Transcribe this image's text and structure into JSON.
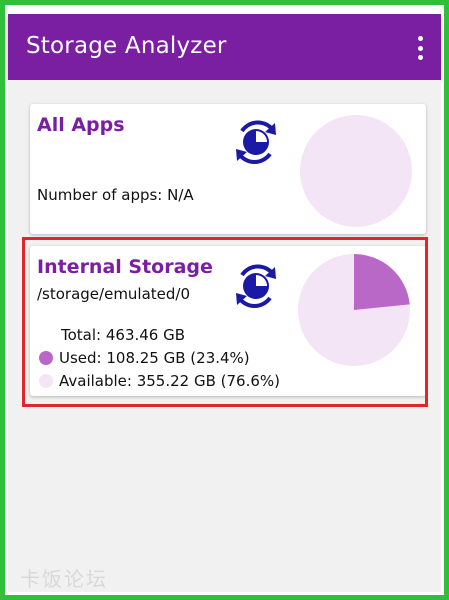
{
  "app_bar": {
    "title": "Storage Analyzer",
    "menu_icon": "more-vert-icon"
  },
  "apps_card": {
    "title": "All Apps",
    "count_text": "Number of apps: N/A",
    "refresh_icon": "refresh-pie-icon",
    "pie_color": "#f3e5f5"
  },
  "storage_card": {
    "title": "Internal Storage",
    "path": "/storage/emulated/0",
    "total": "Total: 463.46 GB",
    "used": "Used: 108.25 GB (23.4%)",
    "available": "Available: 355.22 GB (76.6%)",
    "used_fraction": 0.234,
    "colors": {
      "used": "#ba68c8",
      "available": "#f3e5f5"
    },
    "refresh_icon": "refresh-pie-icon"
  },
  "colors": {
    "primary": "#7b1fa2",
    "highlight": "#e0262a",
    "frame": "#2fbf3a"
  },
  "watermark": "卡饭论坛"
}
